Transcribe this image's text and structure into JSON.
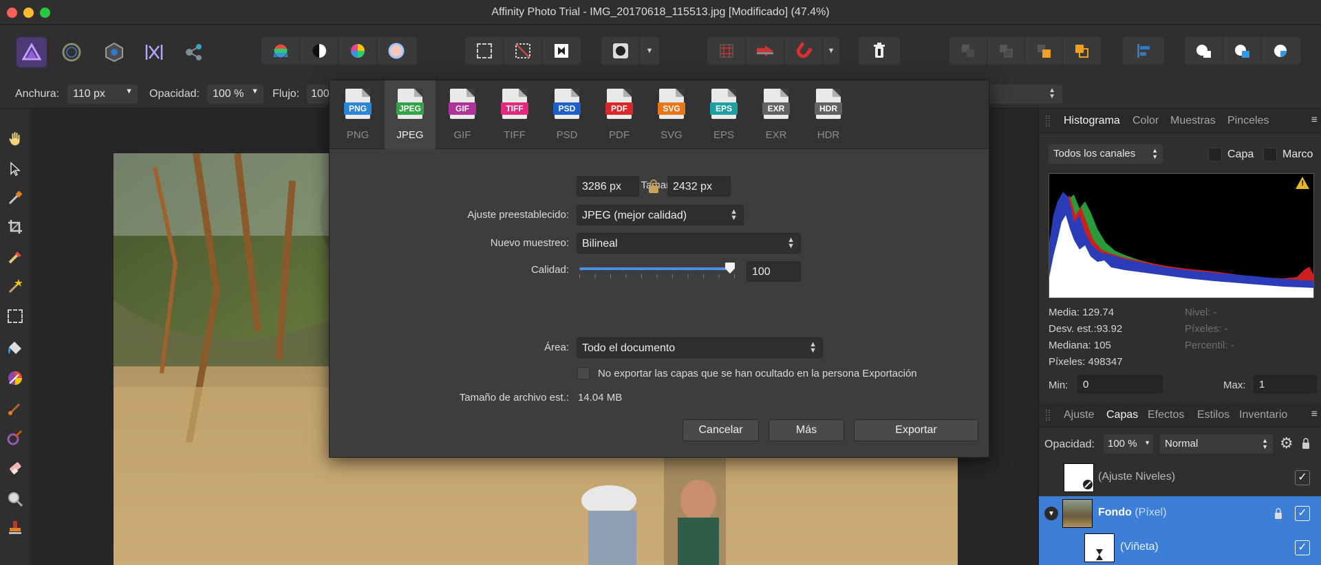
{
  "window": {
    "title": "Affinity Photo Trial - IMG_20170618_115513.jpg [Modificado] (47.4%)",
    "traffic_colors": [
      "#fc5f57",
      "#fdbc2e",
      "#28c840"
    ]
  },
  "toolbar": {
    "personas": [
      "photo-persona-icon",
      "liquify-persona-icon",
      "develop-persona-icon",
      "tone-mapping-persona-icon",
      "export-persona-icon"
    ],
    "adjust": [
      "levels-icon",
      "auto-contrast-icon",
      "color-wheel-icon",
      "white-balance-icon"
    ],
    "selection": [
      "marquee-icon",
      "deselect-icon",
      "invert-selection-icon"
    ],
    "mask": [
      "quick-mask-icon",
      "dropdown-icon"
    ],
    "snap": [
      "grid-icon",
      "move-arrow-icon",
      "magnet-icon",
      "dropdown-icon"
    ],
    "misc": [
      "trash-icon"
    ],
    "arrange": [
      "arrange-back-icon",
      "arrange-backward-icon",
      "arrange-forward-icon",
      "arrange-front-icon"
    ],
    "align": [
      "align-left-icon"
    ],
    "boolean": [
      "add-shape-icon",
      "subtract-shape-icon",
      "intersect-shape-icon"
    ]
  },
  "context": {
    "width_label": "Anchura:",
    "width_value": "110 px",
    "opacity_label": "Opacidad:",
    "opacity_value": "100 %",
    "flow_label": "Flujo:",
    "flow_value": "100"
  },
  "tools": [
    "hand-tool-icon",
    "move-tool-icon",
    "color-picker-tool-icon",
    "crop-tool-icon",
    "paint-brush-tool-icon",
    "magic-wand-icon",
    "marquee-tool-icon",
    "flood-fill-tool-icon",
    "gradient-tool-icon",
    "brush-tool-icon",
    "dodge-tool-icon",
    "eraser-tool-icon",
    "zoom-tool-icon",
    "clone-stamp-icon"
  ],
  "export_dialog": {
    "formats": [
      {
        "name": "PNG",
        "color": "#2b86d6"
      },
      {
        "name": "JPEG",
        "color": "#34a24a"
      },
      {
        "name": "GIF",
        "color": "#b0339a"
      },
      {
        "name": "TIFF",
        "color": "#e0297a"
      },
      {
        "name": "PSD",
        "color": "#1f5fc8"
      },
      {
        "name": "PDF",
        "color": "#d9282a"
      },
      {
        "name": "SVG",
        "color": "#e8771c"
      },
      {
        "name": "EPS",
        "color": "#1e9fa3"
      },
      {
        "name": "EXR",
        "color": "#616161"
      },
      {
        "name": "HDR",
        "color": "#616161"
      }
    ],
    "active_format": "JPEG",
    "size_label": "Tamaño:",
    "size_width": "3286 px",
    "size_height": "2432 px",
    "preset_label": "Ajuste preestablecido:",
    "preset_value": "JPEG (mejor calidad)",
    "resample_label": "Nuevo muestreo:",
    "resample_value": "Bilineal",
    "quality_label": "Calidad:",
    "quality_value": "100",
    "quality_fraction": 1.0,
    "area_label": "Área:",
    "area_value": "Todo el documento",
    "hidden_layers_label": "No exportar las capas que se han ocultado en la persona Exportación",
    "filesize_label": "Tamaño de archivo est.:",
    "filesize_value": "14.04 MB",
    "cancel_label": "Cancelar",
    "more_label": "Más",
    "export_label": "Exportar"
  },
  "histogram_panel": {
    "tabs": [
      "Histograma",
      "Color",
      "Muestras",
      "Pinceles"
    ],
    "channel_value": "Todos los canales",
    "layer_label": "Capa",
    "marquee_label": "Marco",
    "stats": [
      "Media: 129.74",
      "Desv. est.:93.92",
      "Mediana: 105",
      "Píxeles: 498347"
    ],
    "stats_right": [
      "Nivel: -",
      "Píxeles: -",
      "Percentil: -"
    ],
    "min_label": "Min:",
    "min_value": "0",
    "max_label": "Max:",
    "max_value": "1"
  },
  "layers_panel": {
    "tabs": [
      "Ajuste",
      "Capas",
      "Efectos",
      "Estilos",
      "Inventario"
    ],
    "opacity_label": "Opacidad:",
    "opacity_value": "100 %",
    "blend_value": "Normal",
    "layers": [
      {
        "name": "(Ajuste Niveles)",
        "sub": "",
        "selected": false
      },
      {
        "name": "Fondo",
        "sub": "(Píxel)",
        "selected": true
      },
      {
        "name": "(Viñeta)",
        "sub": "",
        "selected": true
      }
    ],
    "selected_color": "#3d7fd6"
  }
}
